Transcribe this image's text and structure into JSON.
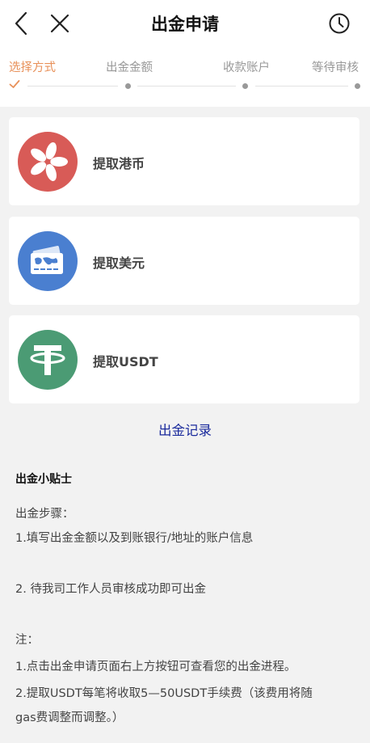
{
  "header": {
    "title": "出金申请",
    "back_icon": "chevron-left-icon",
    "close_icon": "close-icon",
    "history_icon": "clock-icon"
  },
  "steps": [
    {
      "label": "选择方式",
      "active": true
    },
    {
      "label": "出金金额",
      "active": false
    },
    {
      "label": "收款账户",
      "active": false
    },
    {
      "label": "等待审核",
      "active": false
    }
  ],
  "colors": {
    "accent": "#e8915a",
    "hkd_icon_bg": "#d85b57",
    "usd_icon_bg": "#4a7fd0",
    "usdt_icon_bg": "#4b9b74",
    "link": "#1a2a9c"
  },
  "options": [
    {
      "label": "提取港币",
      "icon": "bauhinia-flower-icon"
    },
    {
      "label": "提取美元",
      "icon": "world-card-icon"
    },
    {
      "label": "提取USDT",
      "icon": "tether-icon"
    }
  ],
  "records_link": "出金记录",
  "tips": {
    "title": "出金小贴士",
    "steps_heading": "出金步骤：",
    "step1": "1.填写出金金额以及到账银行/地址的账户信息",
    "step2": "2. 待我司工作人员审核成功即可出金",
    "note_heading": "注：",
    "note1": "1.点击出金申请页面右上方按钮可查看您的出金进程。",
    "note2_line1": "2.提取USDT每笔将收取5—50USDT手续费（该费用将随",
    "note2_line2": "gas费调整而调整。）"
  }
}
